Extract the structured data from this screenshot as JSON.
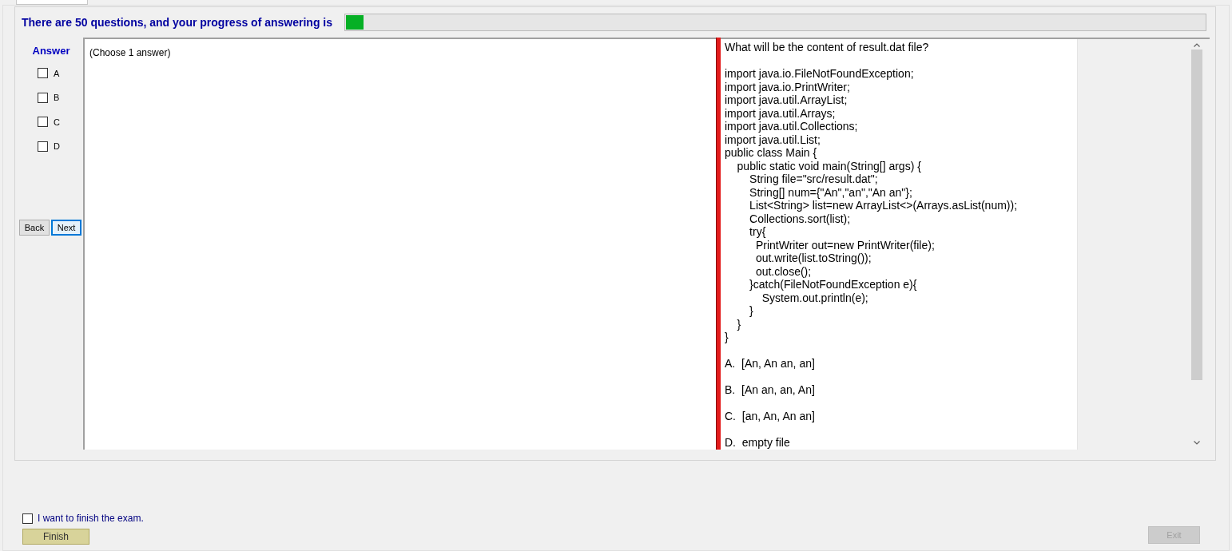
{
  "header": {
    "text": "There are 50 questions, and your progress of answering is",
    "progress": {
      "level": 0.02
    }
  },
  "answer_panel": {
    "title": "Answer",
    "options": [
      {
        "label": "A",
        "checked": false
      },
      {
        "label": "B",
        "checked": false
      },
      {
        "label": "C",
        "checked": false
      },
      {
        "label": "D",
        "checked": false
      }
    ],
    "buttons": [
      {
        "label": "Back",
        "focused": false
      },
      {
        "label": "Next",
        "focused": true
      }
    ]
  },
  "answer_area": {
    "text": "(Choose 1 answer)"
  },
  "question": {
    "blocks": [
      [
        "What will be the content of result.dat file?"
      ],
      [
        "import java.io.FileNotFoundException;",
        "import java.io.PrintWriter;",
        "import java.util.ArrayList;",
        "import java.util.Arrays;",
        "import java.util.Collections;",
        "import java.util.List;",
        "public class Main {",
        "    public static void main(String[] args) {",
        "        String file=\"src/result.dat\";",
        "        String[] num={\"An\",\"an\",\"An an\"};",
        "        List<String> list=new ArrayList<>(Arrays.asList(num));",
        "        Collections.sort(list);",
        "        try{",
        "          PrintWriter out=new PrintWriter(file);",
        "          out.write(list.toString());",
        "          out.close();",
        "        }catch(FileNotFoundException e){",
        "            System.out.println(e);",
        "        }",
        "    }",
        "}"
      ],
      [
        "A.  [An, An an, an]"
      ],
      [
        "B.  [An an, an, An]"
      ],
      [
        "C.  [an, An, An an]"
      ],
      [
        "D.  empty file"
      ]
    ]
  },
  "footer": {
    "finish_check": {
      "label": "I want to finish the exam.",
      "checked": false
    },
    "finish_button": {
      "label": "Finish",
      "disabled": false
    },
    "exit_button": {
      "label": "Exit",
      "disabled": true
    }
  }
}
